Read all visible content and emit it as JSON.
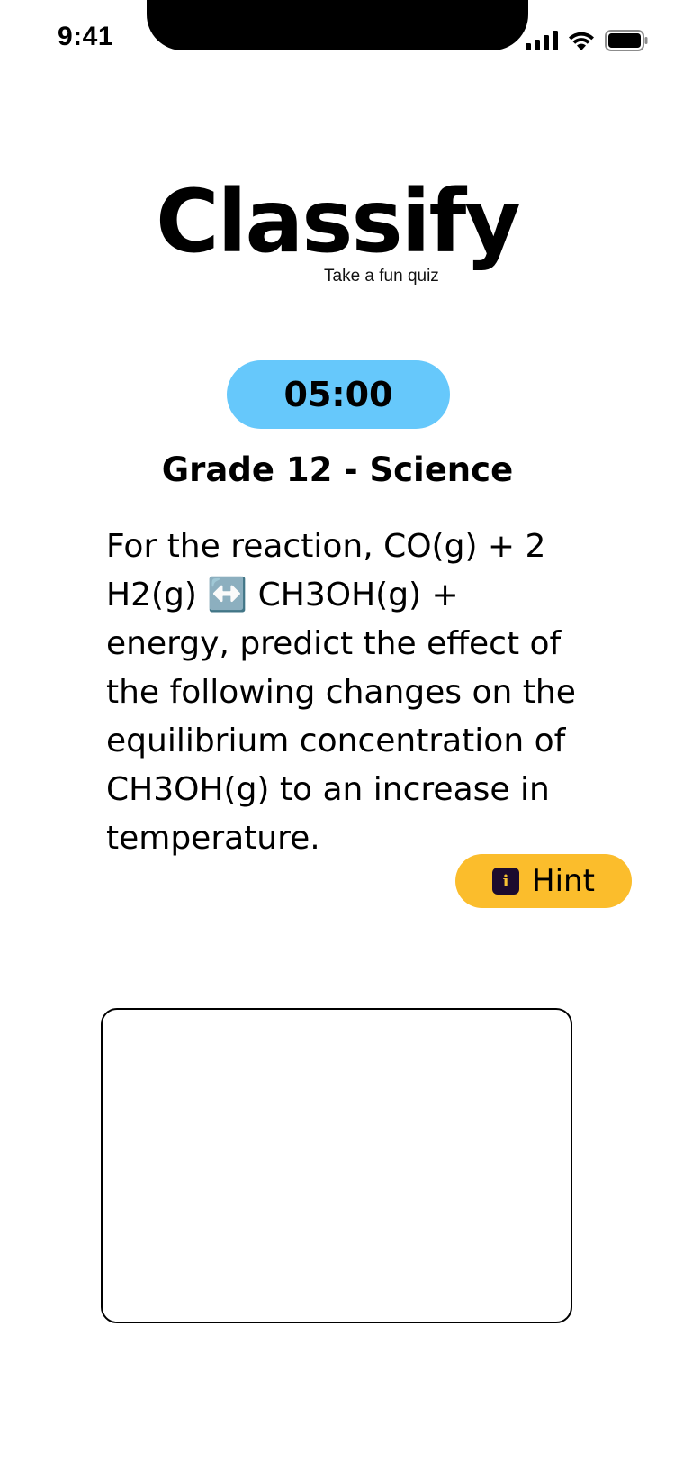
{
  "status_bar": {
    "time": "9:41",
    "icons": [
      "signal-icon",
      "wifi-icon",
      "battery-icon"
    ]
  },
  "app": {
    "name": "Classify",
    "tagline": "Take a fun quiz"
  },
  "quiz": {
    "timer": "05:00",
    "grade_title": "Grade 12 - Science",
    "question": "For the reaction, CO(g) + 2 H2(g) ↔️ CH3OH(g) + energy, predict the effect of the following changes on the equilibrium concentration of CH3OH(g) to an increase in temperature.",
    "hint_label": "Hint",
    "hint_icon": "info-icon",
    "answer_value": ""
  },
  "colors": {
    "timer_bg": "#66c8fb",
    "hint_bg": "#fbbd2c",
    "hint_icon_bg": "#1c0b2e"
  }
}
